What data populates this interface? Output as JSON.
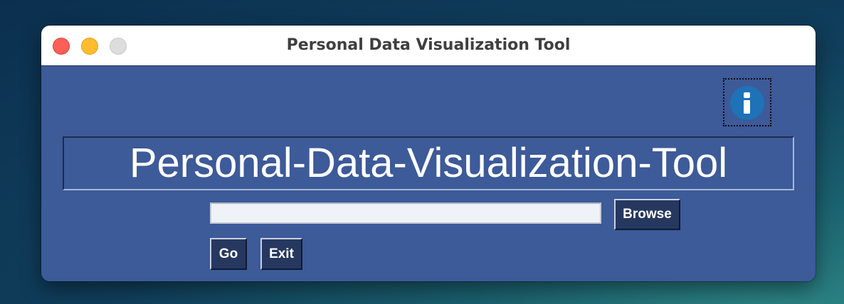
{
  "window": {
    "title": "Personal Data Visualization Tool"
  },
  "app": {
    "banner_title": "Personal-Data-Visualization-Tool",
    "info_icon": "info-circle-icon",
    "file_path": {
      "value": "",
      "placeholder": ""
    },
    "buttons": {
      "browse": "Browse",
      "go": "Go",
      "exit": "Exit"
    }
  },
  "colors": {
    "background": "#3d5a99",
    "button": "#26385f",
    "info_icon": "#1d72b8",
    "text": "#ffffff"
  }
}
